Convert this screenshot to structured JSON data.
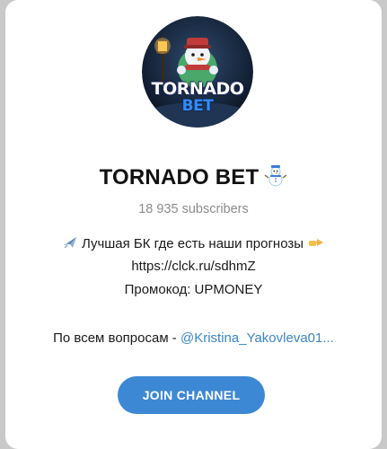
{
  "channel": {
    "logo": {
      "line1": "TORNADO",
      "line2": "BET"
    },
    "title": "TORNADO BET",
    "title_emoji": "snowman-icon",
    "subscribers": "18 935 subscribers",
    "description": {
      "line1_icon": "airplane-icon",
      "line1_text": "Лучшая БК где есть наши прогнозы",
      "line1_icon_end": "pointing-hand-icon",
      "line2": "https://clck.ru/sdhmZ",
      "line3": "Промокод: UPMONEY",
      "line4_prefix": "По всем вопросам -",
      "line4_mention": "@Kristina_Yakovleva01..."
    },
    "join_label": "JOIN CHANNEL"
  },
  "colors": {
    "accent": "#3d88d4",
    "mention": "#3a86c8",
    "muted": "#8c8c8c"
  }
}
